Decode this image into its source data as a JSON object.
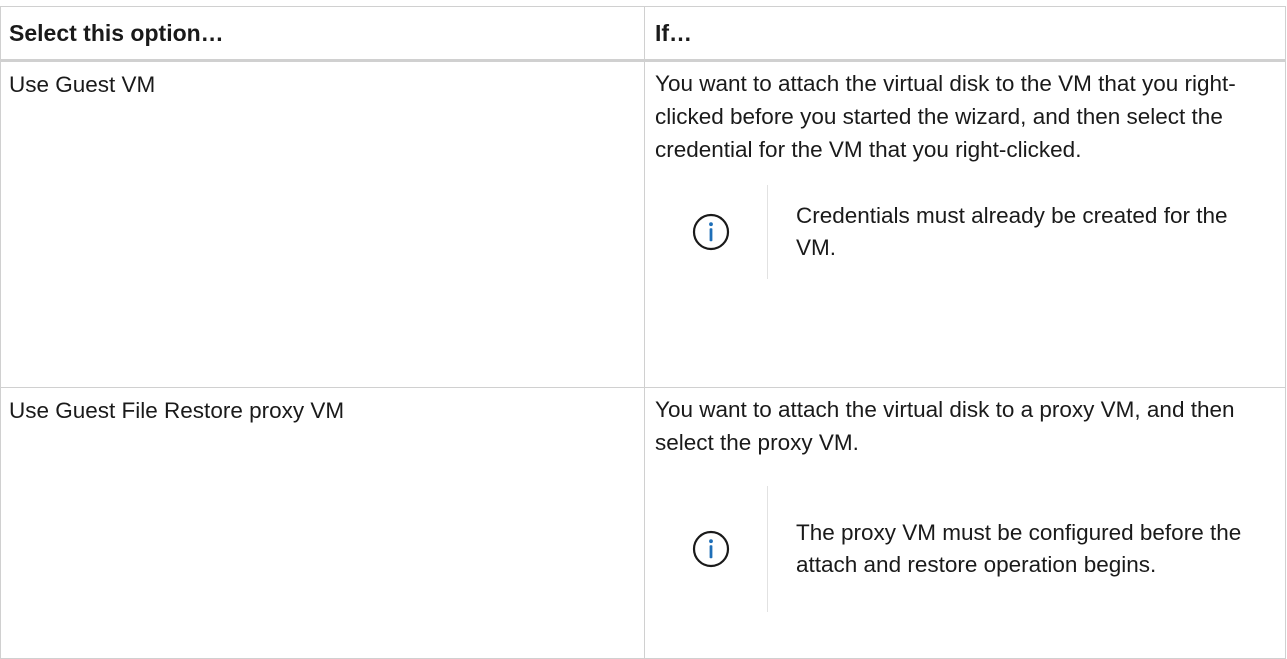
{
  "table": {
    "headers": [
      "Select this option…",
      "If…"
    ],
    "rows": [
      {
        "option": "Use Guest VM",
        "condition": "You want to attach the virtual disk to the VM that you right-clicked before you started the wizard, and then select the credential for the VM that you right-clicked.",
        "note": {
          "icon": "info-icon",
          "text": "Credentials must already be created for the VM."
        }
      },
      {
        "option": "Use Guest File Restore proxy VM",
        "condition": "You want to attach the virtual disk to a proxy VM, and then select the proxy VM.",
        "note": {
          "icon": "info-icon",
          "text": "The proxy VM must be configured before the attach and restore operation begins."
        }
      }
    ]
  },
  "colors": {
    "border": "#d0d0d0",
    "icon": "#1f6fb8",
    "text": "#1a1a1a"
  }
}
